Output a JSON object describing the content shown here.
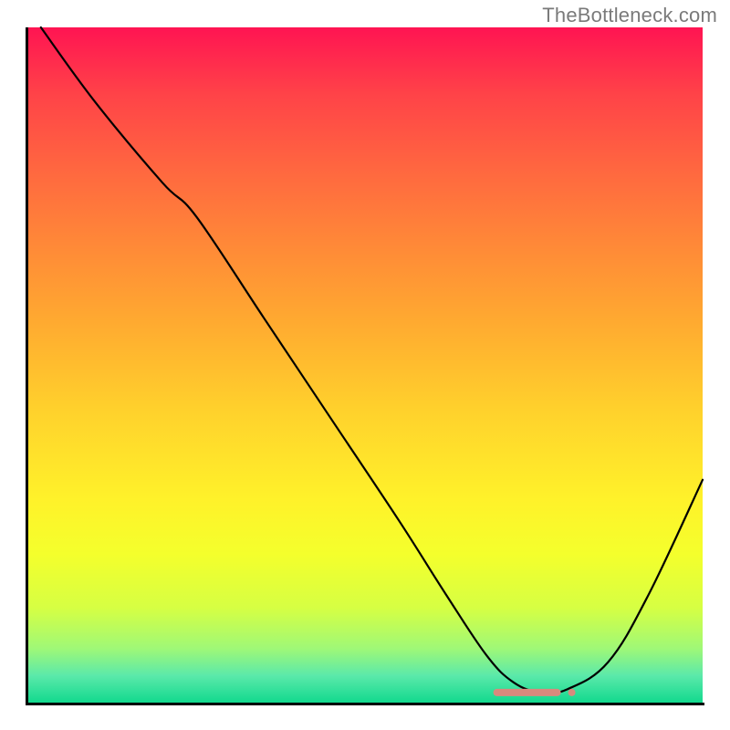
{
  "watermark": "TheBottleneck.com",
  "chart_data": {
    "type": "line",
    "title": "",
    "xlabel": "",
    "ylabel": "",
    "xlim": [
      0,
      100
    ],
    "ylim": [
      0,
      100
    ],
    "grid": false,
    "series": [
      {
        "name": "bottleneck-curve",
        "x": [
          2,
          10,
          20,
          25,
          35,
          45,
          55,
          62,
          68,
          72,
          76,
          80,
          86,
          92,
          100
        ],
        "y": [
          100,
          89,
          77,
          72,
          57,
          42,
          27,
          16,
          7,
          3,
          1.5,
          2,
          6,
          16,
          33
        ],
        "color": "#000000"
      }
    ],
    "markers": [
      {
        "name": "optimal-region",
        "x": 74,
        "y": 1.5,
        "width": 10,
        "color": "#d88a7d"
      }
    ],
    "background": "red-yellow-green vertical gradient"
  }
}
